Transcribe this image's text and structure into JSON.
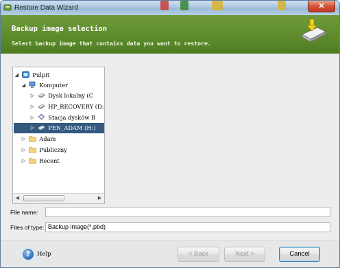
{
  "window": {
    "title": "Restore Data Wizard"
  },
  "header": {
    "title": "Backup image selection",
    "subtitle": "Select backup image that contains data you want to restore."
  },
  "tree": {
    "items": [
      {
        "label": "Pulpit",
        "arrow": "◢",
        "icon": "desktop-icon"
      },
      {
        "label": "Komputer",
        "arrow": "◢",
        "icon": "computer-icon"
      },
      {
        "label": "Dysk lokalny (C",
        "arrow": "▷",
        "icon": "drive-icon"
      },
      {
        "label": "HP_RECOVERY (D:",
        "arrow": "▷",
        "icon": "drive-icon"
      },
      {
        "label": "Stacja dysków B",
        "arrow": "▷",
        "icon": "floppy-icon"
      },
      {
        "label": "PEN_ADAM (H:)",
        "arrow": "▷",
        "icon": "usb-drive-icon",
        "selected": true
      },
      {
        "label": "Adam",
        "arrow": "▷",
        "icon": "folder-icon"
      },
      {
        "label": "Publiczny",
        "arrow": "▷",
        "icon": "folder-icon"
      },
      {
        "label": "Recent",
        "arrow": "▷",
        "icon": "folder-icon"
      }
    ]
  },
  "form": {
    "file_name_label": "File name:",
    "file_name_value": "",
    "files_of_type_label": "Files of type:",
    "files_of_type_value": "Backup image(*.pbd)"
  },
  "footer": {
    "help_label": "Help",
    "back_label": "< Back",
    "next_label": "Next >",
    "cancel_label": "Cancel"
  },
  "colors": {
    "header_green": "#5c8a2a",
    "selection_blue": "#33597f",
    "close_red": "#c2381f"
  }
}
